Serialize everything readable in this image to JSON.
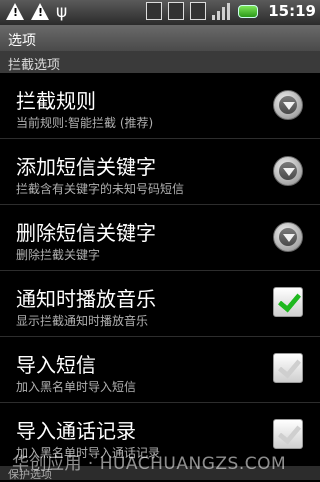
{
  "status_bar": {
    "time": "15:19",
    "icons": [
      "warning-icon",
      "warning-icon",
      "usb-icon",
      "wifi-icon",
      "mute-icon",
      "sim-icon",
      "signal-icon",
      "battery-icon"
    ]
  },
  "title": "选项",
  "section_header": "拦截选项",
  "items": [
    {
      "title": "拦截规则",
      "subtitle": "当前规则:智能拦截 (推荐)",
      "control": "dropdown"
    },
    {
      "title": "添加短信关键字",
      "subtitle": "拦截含有关键字的未知号码短信",
      "control": "dropdown"
    },
    {
      "title": "删除短信关键字",
      "subtitle": "删除拦截关键字",
      "control": "dropdown"
    },
    {
      "title": "通知时播放音乐",
      "subtitle": "显示拦截通知时播放音乐",
      "control": "checkbox",
      "checked": true
    },
    {
      "title": "导入短信",
      "subtitle": "加入黑名单时导入短信",
      "control": "checkbox",
      "checked": false
    },
    {
      "title": "导入通话记录",
      "subtitle": "加入黑名单时导入通话记录",
      "control": "checkbox",
      "checked": false
    }
  ],
  "next_section_peek": "保护选项",
  "watermark": "华创应用 · HUACHUANGZS.COM",
  "colors": {
    "checkbox_checked": "#1fb81f",
    "background": "#000000",
    "title_bar": "#5a5a5a"
  }
}
